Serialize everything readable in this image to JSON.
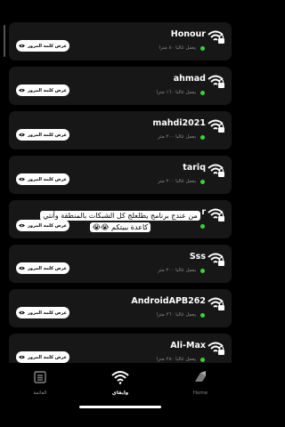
{
  "networks": [
    {
      "ssid": "Honour",
      "range": "يعمل غالبا ٨٠ مترا",
      "password_button": "عرض كلمة المرور"
    },
    {
      "ssid": "ahmad",
      "range": "يعمل غالبا ١٦٠ مترا",
      "password_button": "عرض كلمة المرور"
    },
    {
      "ssid": "mahdi2021",
      "range": "يعمل غالبا ٢٠٠ متر",
      "password_button": "عرض كلمة المرور"
    },
    {
      "ssid": "tariq",
      "range": "يعمل غالبا ٢٠٠ متر",
      "password_button": "عرض كلمة المرور"
    },
    {
      "ssid": "r",
      "range": "",
      "password_button": "عرض كلمة المرور"
    },
    {
      "ssid": "Sss",
      "range": "يعمل غالبا ٢٠٠ متر",
      "password_button": "عرض كلمة المرور"
    },
    {
      "ssid": "AndroidAPB262",
      "range": "يعمل غالبا ٢٦٠ مترا",
      "password_button": "عرض كلمة المرور"
    },
    {
      "ssid": "Ali-Max",
      "range": "يعمل غالبا ٢٨٠ مترا",
      "password_button": "عرض كلمة المرور"
    }
  ],
  "overlay_caption": "من عندج برنامج يطلعلج كل الشبكات بالمنطقة وأنتي كاعدة ببيتكم 😭😭",
  "tabs": [
    {
      "label": "Home",
      "icon": "home-icon"
    },
    {
      "label": "وايفاي",
      "icon": "wifi-icon",
      "active": true
    },
    {
      "label": "القائمة",
      "icon": "menu-icon"
    }
  ],
  "colors": {
    "card": "#171717",
    "status_dot": "#3ad23a",
    "background": "#000000"
  }
}
